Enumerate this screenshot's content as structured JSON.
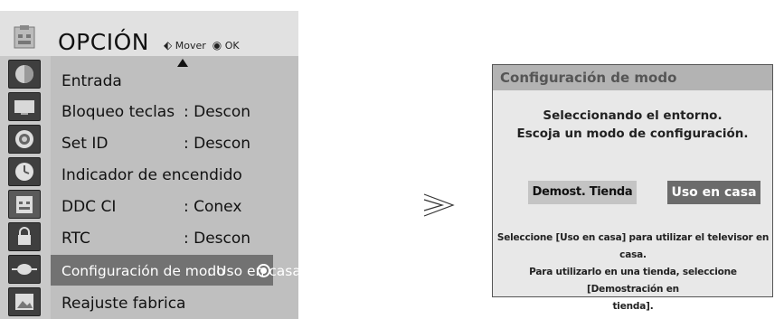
{
  "osd": {
    "title": "OPCIÓN",
    "hint": {
      "move_glyph": "⬖",
      "move_label": "Mover",
      "ok_glyph": "◉",
      "ok_label": "OK"
    },
    "items": [
      {
        "label": "Entrada",
        "value": ""
      },
      {
        "label": "Bloqueo teclas",
        "value": ": Descon"
      },
      {
        "label": "Set ID",
        "value": ": Descon"
      },
      {
        "label": "Indicador de encendido",
        "value": ""
      },
      {
        "label": "DDC CI",
        "value": ": Conex"
      },
      {
        "label": "RTC",
        "value": ": Descon"
      },
      {
        "label": "Configuración de modo",
        "value": ": Uso en casa",
        "selected": true
      },
      {
        "label": "Reajuste fabrica",
        "value": ""
      }
    ],
    "side_icons": [
      "picture-icon",
      "screen-icon",
      "audio-icon",
      "time-icon",
      "option-icon",
      "lock-icon",
      "input-icon",
      "photo-icon"
    ],
    "active_side_icon": "option-icon"
  },
  "transition": {
    "glyph": "arrow-right-icon"
  },
  "dialog": {
    "title": "Configuración de modo",
    "message_line1": "Seleccionando el entorno.",
    "message_line2": "Escoja un modo de configuración.",
    "btn_store": "Demost. Tienda",
    "btn_home": "Uso en casa",
    "note_line1": "Seleccione [Uso en casa] para utilizar el televisor en casa.",
    "note_line2": "Para utilizarlo en una tienda, seleccione [Demostración en",
    "note_line3": "tienda]."
  },
  "colors": {
    "menu_bg": "#bfbfbf",
    "selected_bg": "#727272",
    "dialog_title_bg": "#b3b3b3",
    "home_btn_bg": "#6b6b6b"
  }
}
